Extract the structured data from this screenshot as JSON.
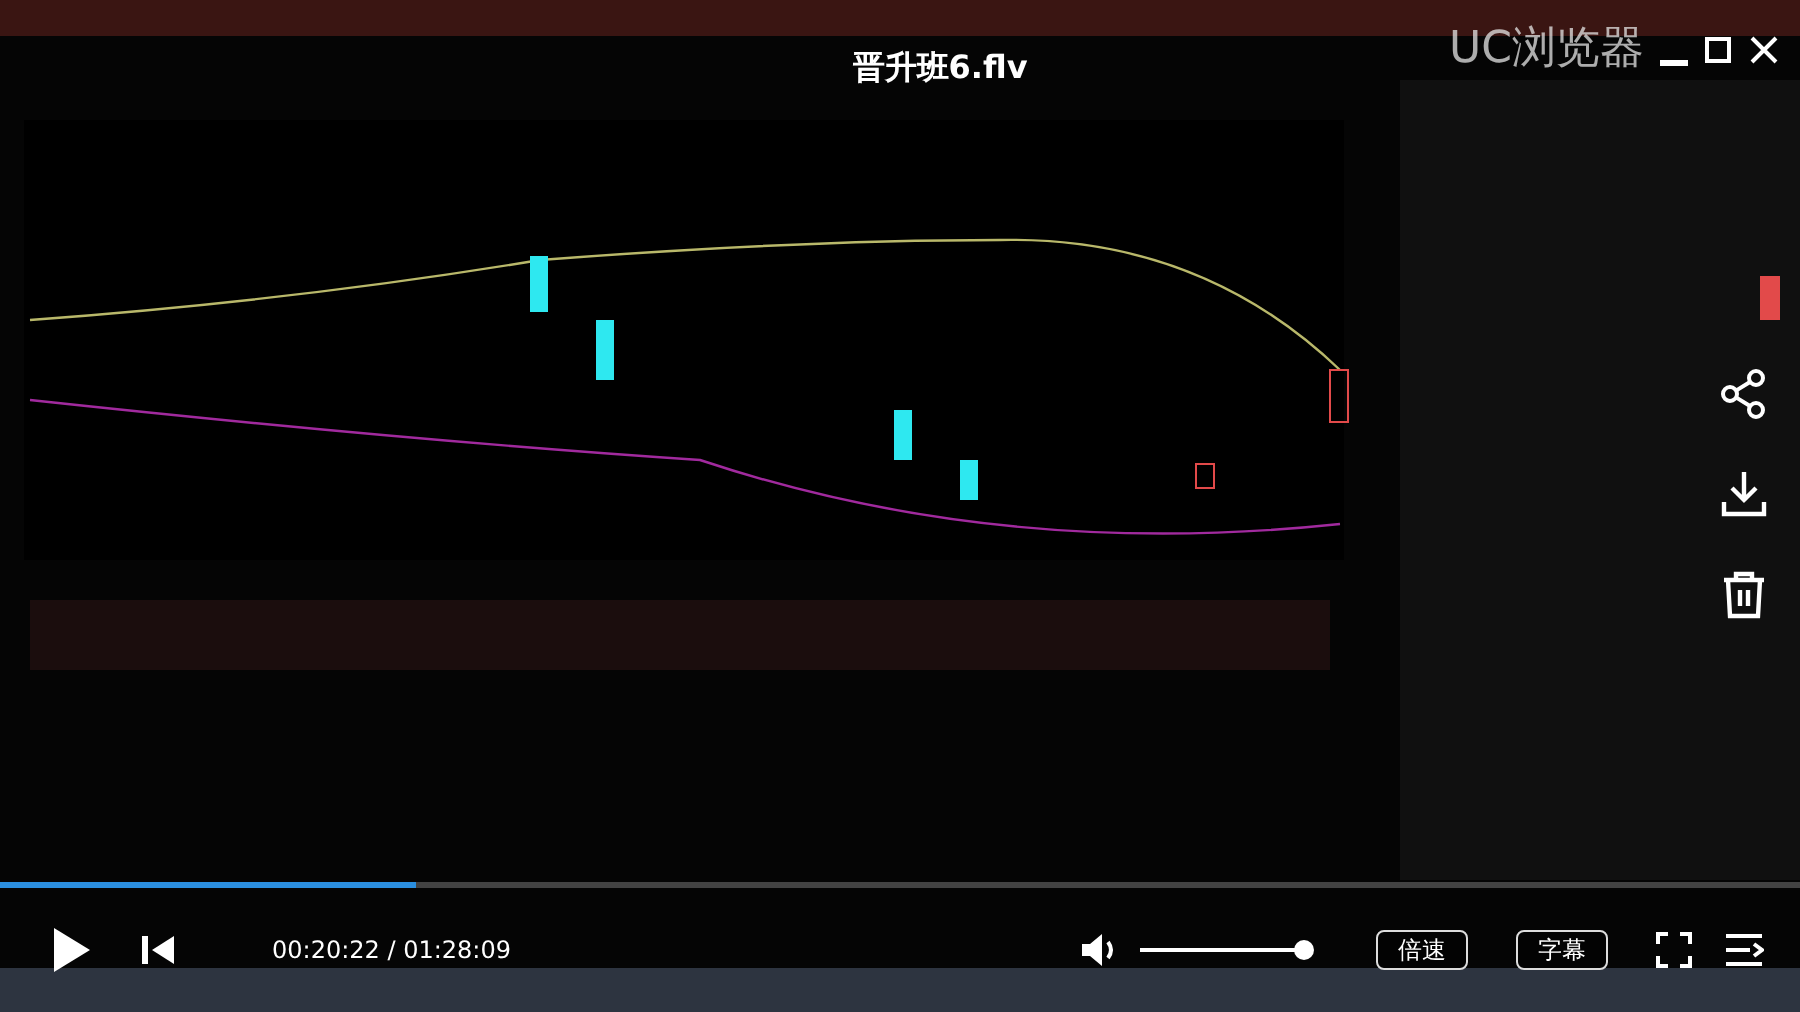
{
  "window": {
    "title": "晋升班6.flv",
    "brand": "UC浏览器"
  },
  "player": {
    "playing": false,
    "progress": {
      "level": 0.231
    },
    "time": "00:20:22 / 01:28:09",
    "volume": {
      "level": 0.95
    },
    "buttons": [
      "倍速",
      "字幕"
    ]
  }
}
